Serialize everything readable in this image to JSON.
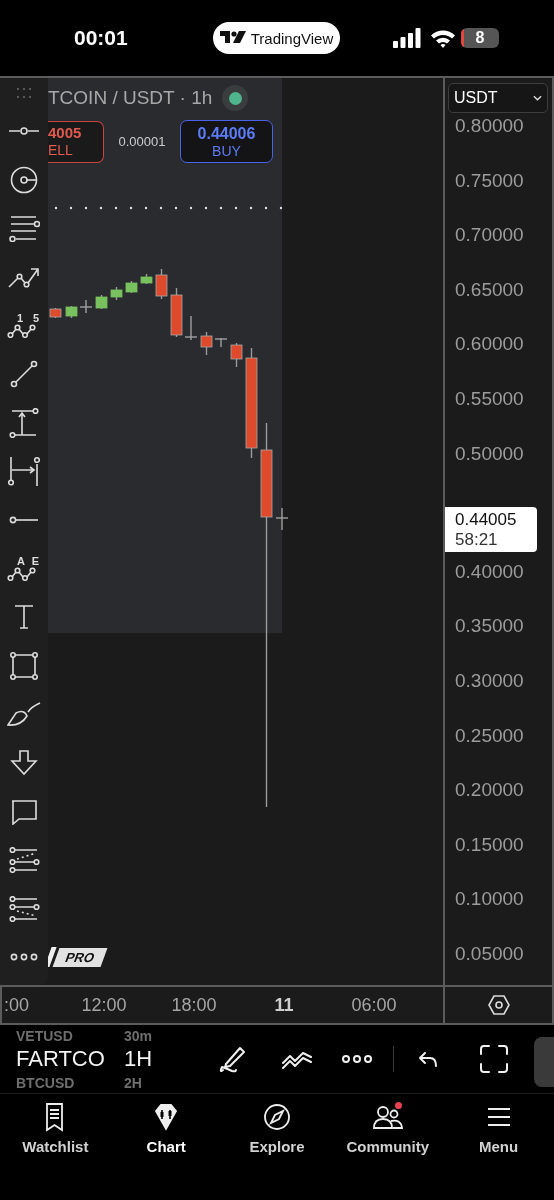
{
  "status_bar": {
    "time": "00:01",
    "app_pill": "TradingView",
    "battery": "8"
  },
  "chart": {
    "header": {
      "symbol": "TCOIN / USDT · 1h",
      "market_open": true,
      "sell": {
        "price": "4005",
        "label": "ELL"
      },
      "spread": "0.00001",
      "buy": {
        "price": "0.44006",
        "label": "BUY"
      }
    },
    "toolbar": [
      {
        "kind": "drag"
      },
      {
        "kind": "horizontal-line"
      },
      {
        "kind": "circle"
      },
      {
        "kind": "parallel"
      },
      {
        "kind": "trend-arrow"
      },
      {
        "kind": "pattern",
        "marks": [
          "1",
          "5"
        ]
      },
      {
        "kind": "trend-line"
      },
      {
        "kind": "price-range"
      },
      {
        "kind": "date-range"
      },
      {
        "kind": "ray"
      },
      {
        "kind": "pattern",
        "marks": [
          "A",
          "E"
        ]
      },
      {
        "kind": "text"
      },
      {
        "kind": "rectangle"
      },
      {
        "kind": "brush"
      },
      {
        "kind": "arrow-down"
      },
      {
        "kind": "comment"
      },
      {
        "kind": "fib-up"
      },
      {
        "kind": "fib-down"
      },
      {
        "kind": "more"
      }
    ],
    "badge": "PRO",
    "currency": "USDT",
    "price_axis": [
      {
        "kind": "tick",
        "label": "0.80000"
      },
      {
        "kind": "tick",
        "label": "0.75000"
      },
      {
        "kind": "tick",
        "label": "0.70000"
      },
      {
        "kind": "tick",
        "label": "0.65000"
      },
      {
        "kind": "tick",
        "label": "0.60000"
      },
      {
        "kind": "tick",
        "label": "0.55000"
      },
      {
        "kind": "tick",
        "label": "0.50000"
      },
      {
        "kind": "current",
        "price": "0.44005",
        "countdown": "58:21"
      },
      {
        "kind": "tick",
        "label": "0.40000"
      },
      {
        "kind": "tick",
        "label": "0.35000"
      },
      {
        "kind": "tick",
        "label": "0.30000"
      },
      {
        "kind": "tick",
        "label": "0.25000"
      },
      {
        "kind": "tick",
        "label": "0.20000"
      },
      {
        "kind": "tick",
        "label": "0.15000"
      },
      {
        "kind": "tick",
        "label": "0.10000"
      },
      {
        "kind": "tick",
        "label": "0.05000"
      }
    ],
    "time_axis": [
      {
        "label": ":00",
        "bold": false
      },
      {
        "label": "12:00",
        "bold": false
      },
      {
        "label": "18:00",
        "bold": false
      },
      {
        "label": "11",
        "bold": true
      },
      {
        "label": "06:00",
        "bold": false
      }
    ]
  },
  "bottom_toolbar": {
    "symbols": [
      {
        "symbol": "VETUSD",
        "interval": "30m",
        "selected": false
      },
      {
        "symbol": "FARTCO",
        "interval": "1H",
        "selected": true
      },
      {
        "symbol": "BTCUSD",
        "interval": "2H",
        "selected": false
      }
    ]
  },
  "tabs": [
    {
      "label": "Watchlist",
      "selected": false,
      "notification": false
    },
    {
      "label": "Chart",
      "selected": true,
      "notification": false
    },
    {
      "label": "Explore",
      "selected": false,
      "notification": false
    },
    {
      "label": "Community",
      "selected": false,
      "notification": true
    },
    {
      "label": "Menu",
      "selected": false,
      "notification": false
    }
  ]
}
